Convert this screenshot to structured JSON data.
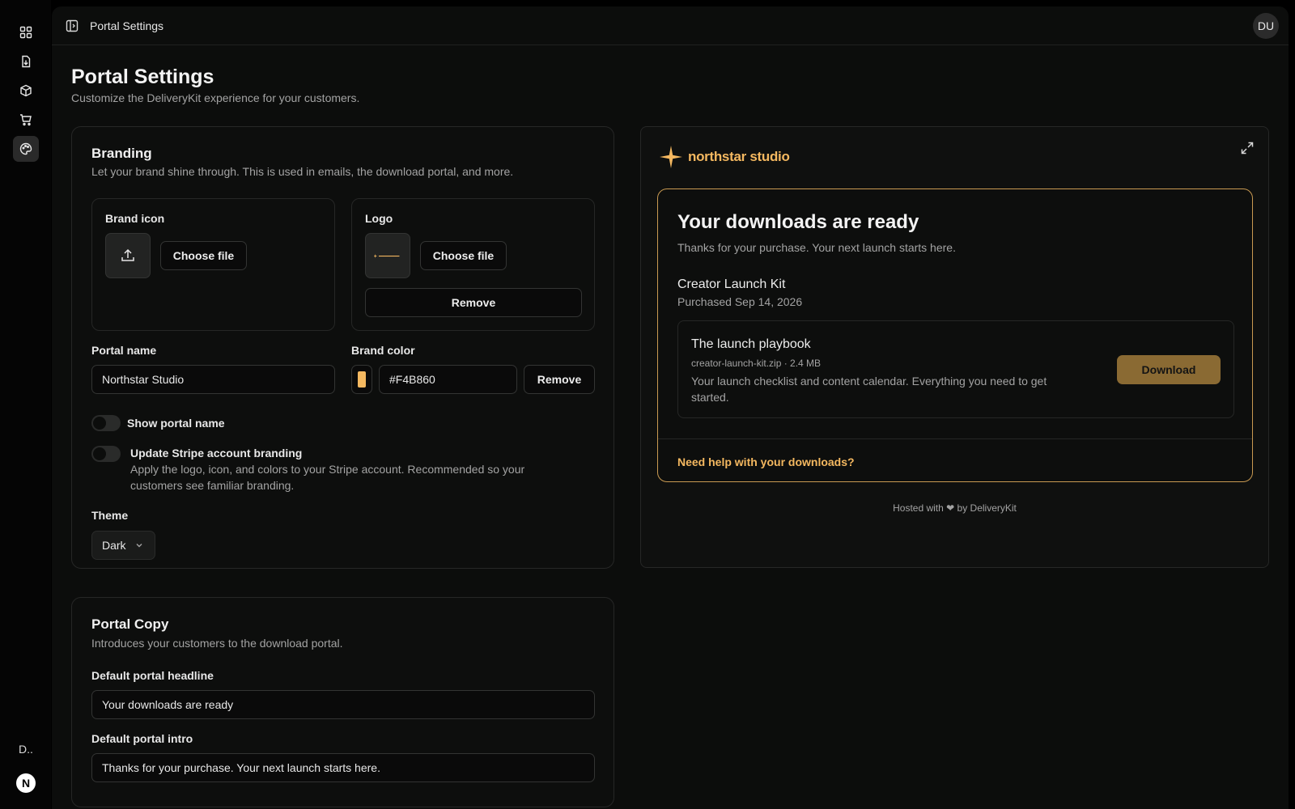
{
  "app": {
    "breadcrumb": "Portal Settings",
    "avatar_initials": "DU",
    "rail_footer_text": "D..",
    "rail_footer_avatar": "N"
  },
  "rail": {
    "items": [
      {
        "icon": "grid-icon"
      },
      {
        "icon": "file-download-icon"
      },
      {
        "icon": "package-icon"
      },
      {
        "icon": "cart-icon"
      },
      {
        "icon": "palette-icon",
        "active": true
      }
    ]
  },
  "page": {
    "title": "Portal Settings",
    "subtitle": "Customize the DeliveryKit experience for your customers."
  },
  "branding": {
    "title": "Branding",
    "subtitle": "Let your brand shine through. This is used in emails, the download portal, and more.",
    "brand_icon_label": "Brand icon",
    "brand_icon_choose": "Choose file",
    "logo_label": "Logo",
    "logo_choose": "Choose file",
    "logo_remove": "Remove",
    "portal_name_label": "Portal name",
    "portal_name_value": "Northstar Studio",
    "brand_color_label": "Brand color",
    "brand_color_value": "#F4B860",
    "brand_color_remove": "Remove",
    "show_portal_name_label": "Show portal name",
    "show_portal_name_on": false,
    "stripe_label": "Update Stripe account branding",
    "stripe_help": "Apply the logo, icon, and colors to your Stripe account. Recommended so your customers see familiar branding.",
    "stripe_on": false,
    "theme_label": "Theme",
    "theme_value": "Dark"
  },
  "portal_copy": {
    "title": "Portal Copy",
    "subtitle": "Introduces your customers to the download portal.",
    "headline_label": "Default portal headline",
    "headline_value": "Your downloads are ready",
    "intro_label": "Default portal intro",
    "intro_value": "Thanks for your purchase. Your next launch starts here."
  },
  "preview": {
    "brand_name": "northstar studio",
    "headline": "Your downloads are ready",
    "intro": "Thanks for your purchase. Your next launch starts here.",
    "product_name": "Creator Launch Kit",
    "purchased": "Purchased Sep 14, 2026",
    "item_title": "The launch playbook",
    "item_meta": "creator-launch-kit.zip · 2.4 MB",
    "item_desc": "Your launch checklist and content calendar. Everything you need to get started.",
    "download_label": "Download",
    "help_link": "Need help with your downloads?",
    "hosted": "Hosted with ❤ by DeliveryKit"
  },
  "colors": {
    "accent": "#F4B860",
    "download_button": "#8A6A33",
    "background": "#0C0D0C"
  }
}
